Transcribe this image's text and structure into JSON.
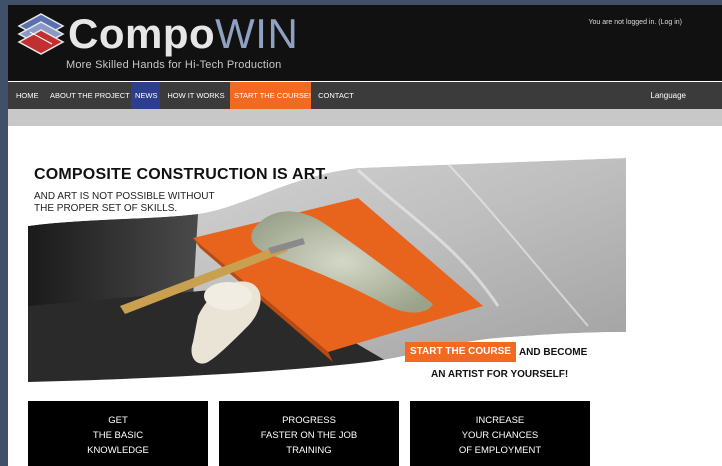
{
  "header": {
    "logo_text_a": "Compo",
    "logo_text_b": "WIN",
    "tagline": "More Skilled Hands for Hi-Tech Production",
    "login_text": "You are not logged in.",
    "login_link": "(Log in)"
  },
  "nav": {
    "items": [
      {
        "label": "HOME"
      },
      {
        "label": "ABOUT THE PROJECT"
      },
      {
        "label": "NEWS"
      },
      {
        "label": "HOW IT WORKS"
      },
      {
        "label": "START THE COURSE!"
      },
      {
        "label": "CONTACT"
      }
    ],
    "language": "Language"
  },
  "hero": {
    "headline": "COMPOSITE CONSTRUCTION IS ART.",
    "sub_line1": "AND ART IS NOT POSSIBLE WITHOUT",
    "sub_line2": "THE PROPER SET OF SKILLS.",
    "cta_button": "START THE COURSE",
    "cta_after": "AND BECOME",
    "cta_line2": "AN ARTIST FOR YOURSELF!"
  },
  "features": [
    {
      "line1": "GET",
      "line2": "THE BASIC",
      "line3": "KNOWLEDGE"
    },
    {
      "line1": "PROGRESS",
      "line2": "FASTER ON THE JOB",
      "line3": "TRAINING"
    },
    {
      "line1": "INCREASE",
      "line2": "YOUR CHANCES",
      "line3": "OF EMPLOYMENT"
    }
  ],
  "colors": {
    "nav_active_news": "#2d3e8f",
    "nav_active_course": "#f26a21",
    "accent_orange": "#f26a21"
  },
  "icons": {
    "logo": "compowin-layers-logo-icon"
  }
}
